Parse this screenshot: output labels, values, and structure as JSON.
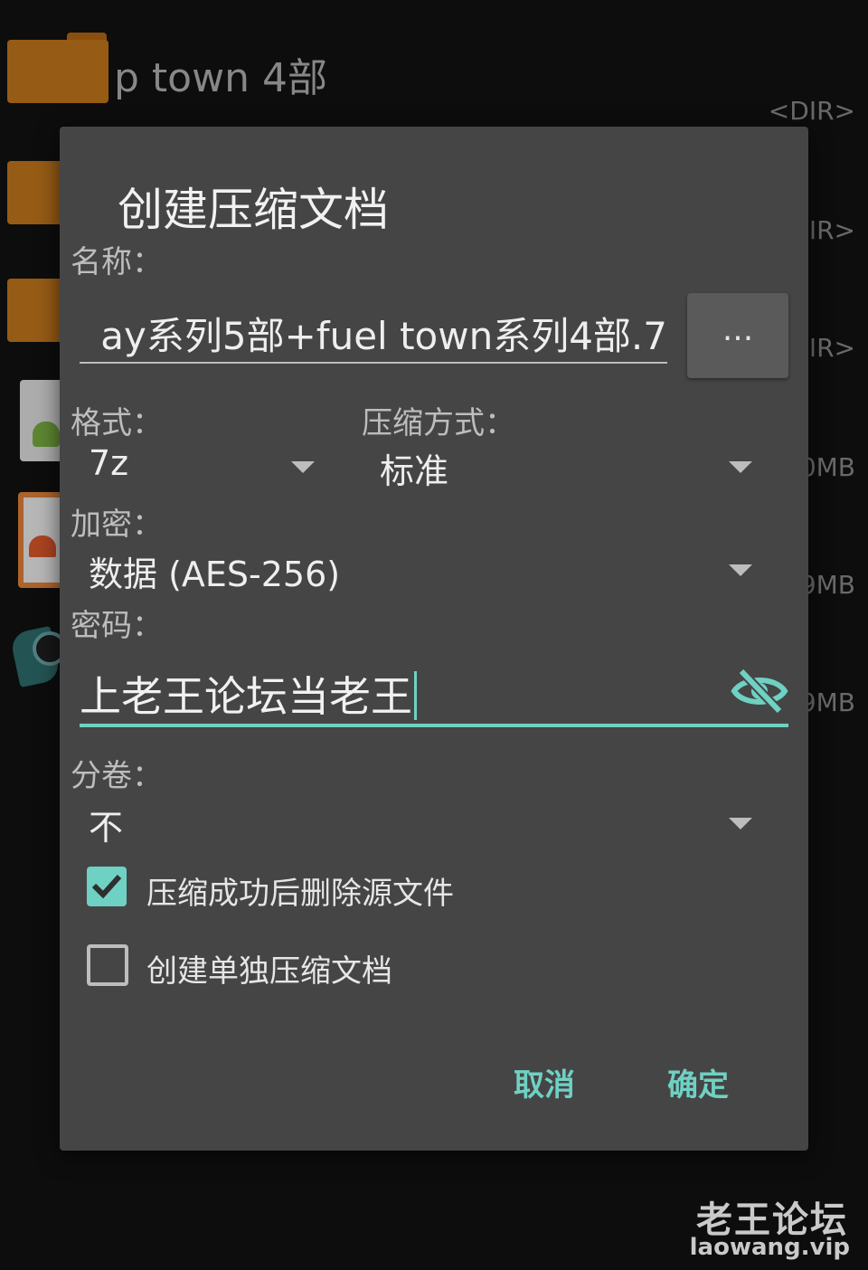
{
  "background_list": {
    "rows": [
      {
        "name": "p town 4部",
        "meta": "<DIR>"
      },
      {
        "meta": "DIR>"
      },
      {
        "meta": "DIR>"
      },
      {
        "meta": "0MB"
      },
      {
        "meta": "9MB"
      },
      {
        "meta": "9MB"
      }
    ]
  },
  "dialog": {
    "title": "创建压缩文档",
    "name_label": "名称：",
    "name_value": "ay系列5部+fuel town系列4部.7",
    "browse_label": "...",
    "format_label": "格式：",
    "format_value": "7z",
    "method_label": "压缩方式：",
    "method_value": "标准",
    "encryption_label": "加密：",
    "encryption_value": "数据 (AES-256)",
    "password_label": "密码：",
    "password_value": "上老王论坛当老王",
    "split_label": "分卷：",
    "split_value": "不",
    "delete_source_label": "压缩成功后删除源文件",
    "delete_source_checked": true,
    "separate_archives_label": "创建单独压缩文档",
    "separate_archives_checked": false,
    "cancel_label": "取消",
    "ok_label": "确定"
  },
  "watermark": {
    "title": "老王论坛",
    "url": "laowang.vip"
  },
  "colors": {
    "accent": "#6fd1c3",
    "dialog_bg": "#454545",
    "screen_bg": "#121212"
  }
}
